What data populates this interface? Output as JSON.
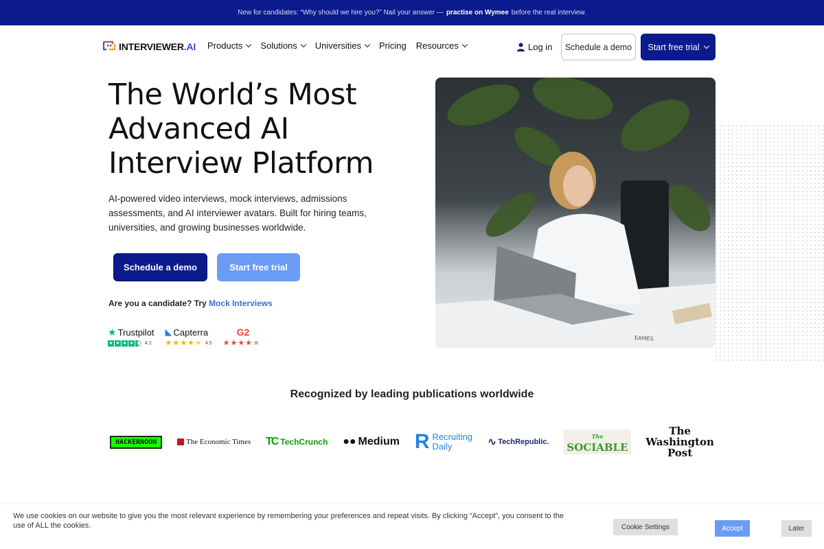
{
  "announcement": {
    "prefix": "New for candidates: “Why should we hire you?” Nail your answer —",
    "link": "practise on Wymee",
    "suffix": "before the real interview."
  },
  "nav": {
    "logo_main": "INTERVIEWER",
    "logo_suffix": ".AI",
    "menu": [
      {
        "label": "Products",
        "dropdown": true
      },
      {
        "label": "Solutions",
        "dropdown": true
      },
      {
        "label": "Universities",
        "dropdown": true
      },
      {
        "label": "Pricing",
        "dropdown": false
      },
      {
        "label": "Resources",
        "dropdown": true
      }
    ],
    "login": "Log in",
    "schedule_demo": "Schedule a demo",
    "start_trial": "Start free trial"
  },
  "hero": {
    "title_lines": [
      "The World’s Most",
      "Advanced AI",
      "Interview Platform"
    ],
    "subtitle": "AI-powered video interviews, mock interviews, admissions assessments, and AI interviewer avatars. Built for hiring teams, universities, and growing businesses worldwide.",
    "cta_demo": "Schedule a demo",
    "cta_trial": "Start free trial",
    "candidate_prefix": "Are you a candidate? Try",
    "candidate_link": "Mock Interviews"
  },
  "ratings": [
    {
      "name": "Trustpilot",
      "score": "4.2",
      "stars": 4.5
    },
    {
      "name": "Capterra",
      "score": "4.5",
      "stars": 4.5
    },
    {
      "name": "G2",
      "score": "",
      "stars": 4.5
    }
  ],
  "recognition": {
    "heading": "Recognized by leading publications worldwide",
    "publications": [
      "HACKERNOON",
      "The Economic Times",
      "TechCrunch",
      "Medium",
      "Recruiting",
      "Daily",
      "TechRepublic.",
      "The",
      "SOCIABLE",
      "The",
      "Washington",
      "Post"
    ]
  },
  "cookie": {
    "text": "We use cookies on our website to give you the most relevant experience by remembering your preferences and repeat visits. By clicking “Accept”, you consent to the use of ALL the cookies.",
    "settings": "Cookie Settings",
    "accept": "Accept",
    "later": "Later"
  },
  "colors": {
    "navy": "#0b1a8c",
    "light_blue": "#6b9cf5",
    "link_blue": "#3a6fd8"
  }
}
